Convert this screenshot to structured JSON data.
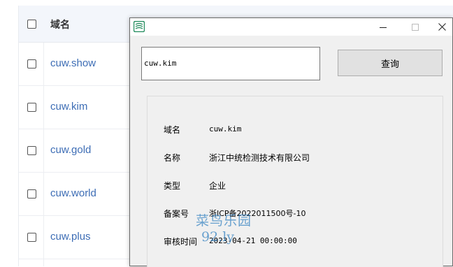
{
  "table": {
    "header": "域名",
    "rows": [
      {
        "domain": "cuw.show"
      },
      {
        "domain": "cuw.kim"
      },
      {
        "domain": "cuw.gold"
      },
      {
        "domain": "cuw.world"
      },
      {
        "domain": "cuw.plus"
      }
    ]
  },
  "dialog": {
    "query_value": "cuw.kim",
    "query_button": "查询",
    "fields": [
      {
        "label": "域名",
        "value": "cuw.kim"
      },
      {
        "label": "名称",
        "value": "浙江中统检测技术有限公司"
      },
      {
        "label": "类型",
        "value": "企业"
      },
      {
        "label": "备案号",
        "value": "浙ICP备2022011500号-10"
      },
      {
        "label": "审核时间",
        "value": "2023-04-21 00:00:00"
      }
    ]
  },
  "watermark": {
    "line1": "菜鸟乐园",
    "line2": "92.ly"
  },
  "icons": {
    "app": "app-logo-icon",
    "minimize": "minimize-icon",
    "maximize": "maximize-icon",
    "close": "close-icon"
  }
}
